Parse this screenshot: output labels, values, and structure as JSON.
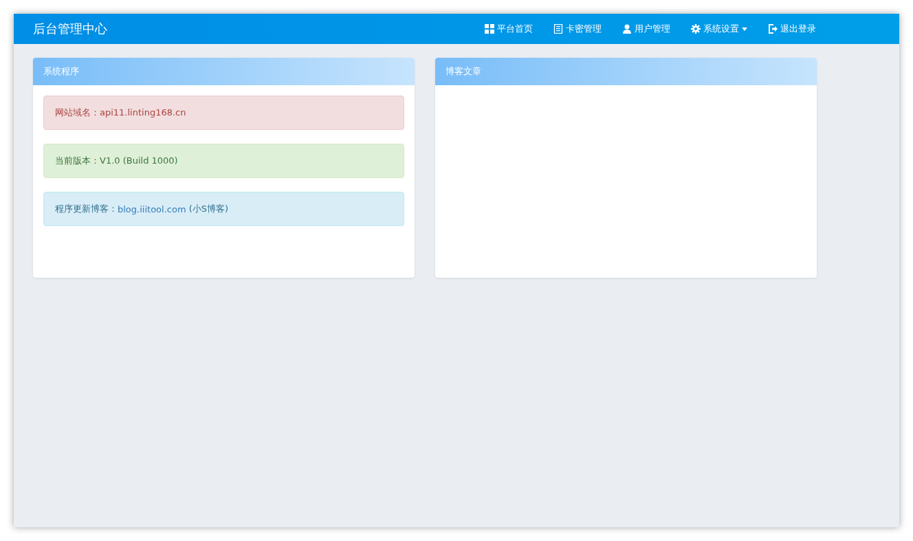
{
  "navbar": {
    "brand": "后台管理中心",
    "items": [
      {
        "label": "平台首页",
        "kind": "grid",
        "dropdown": false
      },
      {
        "label": "卡密管理",
        "kind": "list",
        "dropdown": false
      },
      {
        "label": "用户管理",
        "kind": "user",
        "dropdown": false
      },
      {
        "label": "系统设置",
        "kind": "gear",
        "dropdown": true
      },
      {
        "label": "退出登录",
        "kind": "logout",
        "dropdown": false
      }
    ]
  },
  "panels": [
    {
      "title": "系统程序",
      "alerts": [
        {
          "kind": "danger",
          "label": "网站域名：",
          "value": "api11.linting168.cn"
        },
        {
          "kind": "success",
          "label": "当前版本：",
          "value": "V1.0 (Build 1000)"
        },
        {
          "kind": "info",
          "label": "程序更新博客：",
          "link": "blog.iiitool.com",
          "value": " (小S博客)"
        }
      ]
    },
    {
      "title": "博客文章"
    }
  ]
}
